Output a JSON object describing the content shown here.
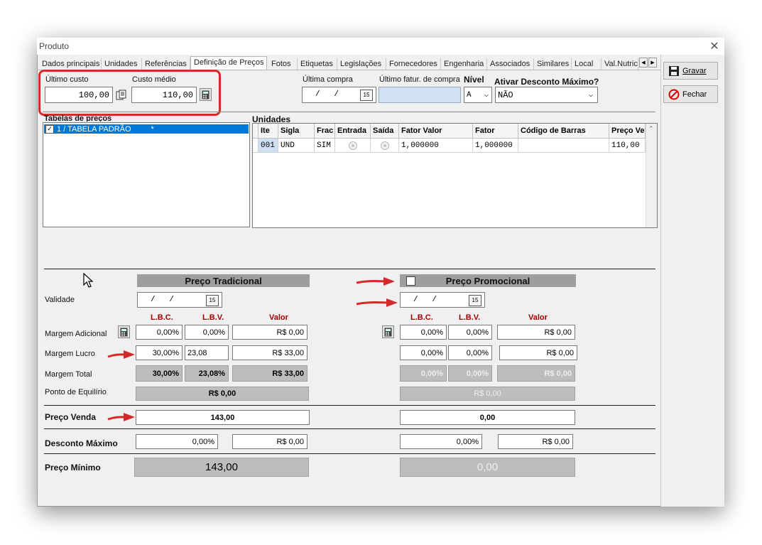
{
  "window": {
    "title": "Produto",
    "close": "✕"
  },
  "tabs": [
    "Dados principais",
    "Unidades",
    "Referências",
    "Definição de Preços",
    "Fotos",
    "Etiquetas",
    "Legislações",
    "Fornecedores",
    "Engenharia",
    "Associados",
    "Similares",
    "Local",
    "Val.Nutric"
  ],
  "active_tab": "Definição de Preços",
  "actions": {
    "save": "Gravar",
    "close": "Fechar"
  },
  "costs": {
    "ultimo_custo_label": "Último custo",
    "ultimo_custo": "100,00",
    "custo_medio_label": "Custo médio",
    "custo_medio": "110,00"
  },
  "purchase": {
    "ultima_compra_label": "Última compra",
    "ultima_compra": "/   /",
    "ultimo_fatur_label": "Último fatur. de compra",
    "ultimo_fatur": "",
    "nivel_label": "Nível",
    "nivel": "A",
    "desconto_label": "Ativar Desconto Máximo?",
    "desconto": "NÃO"
  },
  "tabelas": {
    "label": "Tabelas de preços",
    "items": [
      {
        "text": "1 / TABELA PADRÃO",
        "flag": "*",
        "checked": true
      }
    ]
  },
  "unidades": {
    "label": "Unidades",
    "columns": [
      "Ite",
      "Sigla",
      "Frac",
      "Entrada",
      "Saída",
      "Fator Valor",
      "Fator",
      "Código de Barras",
      "Preço Ve"
    ],
    "rows": [
      {
        "ite": "001",
        "sigla": "UND",
        "frac": "SIM",
        "fator_valor": "1,000000",
        "fator": "1,000000",
        "codigo": "",
        "preco": "110,00"
      }
    ]
  },
  "tradicional": {
    "header": "Preço Tradicional",
    "validade": "/   /",
    "col_lbc": "L.B.C.",
    "col_lbv": "L.B.V.",
    "col_valor": "Valor",
    "adicional": {
      "lbc": "0,00%",
      "lbv": "0,00%",
      "valor": "R$ 0,00"
    },
    "lucro": {
      "lbc": "30,00%",
      "lbv": "23,08",
      "valor": "R$ 33,00"
    },
    "total": {
      "lbc": "30,00%",
      "lbv": "23,08%",
      "valor": "R$ 33,00"
    },
    "equilibrio": "R$ 0,00",
    "preco_venda": "143,00",
    "desconto": {
      "pct": "0,00%",
      "valor": "R$ 0,00"
    },
    "preco_minimo": "143,00"
  },
  "promocional": {
    "header": "Preço Promocional",
    "checked": false,
    "validade": "/   /",
    "col_lbc": "L.B.C.",
    "col_lbv": "L.B.V.",
    "col_valor": "Valor",
    "adicional": {
      "lbc": "0,00%",
      "lbv": "0,00%",
      "valor": "R$ 0,00"
    },
    "lucro": {
      "lbc": "0,00%",
      "lbv": "0,00%",
      "valor": "R$ 0,00"
    },
    "total": {
      "lbc": "0,00%",
      "lbv": "0,00%",
      "valor": "R$ 0,00"
    },
    "equilibrio": "R$ 0,00",
    "preco_venda": "0,00",
    "desconto": {
      "pct": "0,00%",
      "valor": "R$ 0,00"
    },
    "preco_minimo": "0,00"
  },
  "row_labels": {
    "validade": "Validade",
    "adicional": "Margem Adicional",
    "lucro": "Margem Lucro",
    "total": "Margem Total",
    "equilibrio": "Ponto de Equilírio",
    "venda": "Preço Venda",
    "desconto": "Desconto Máximo",
    "minimo": "Preço Mínimo"
  },
  "colors": {
    "highlight_box": "#d42a2a",
    "arrow": "#d42a2a",
    "selection": "#0078d7",
    "section_bar": "#9e9e9e"
  }
}
